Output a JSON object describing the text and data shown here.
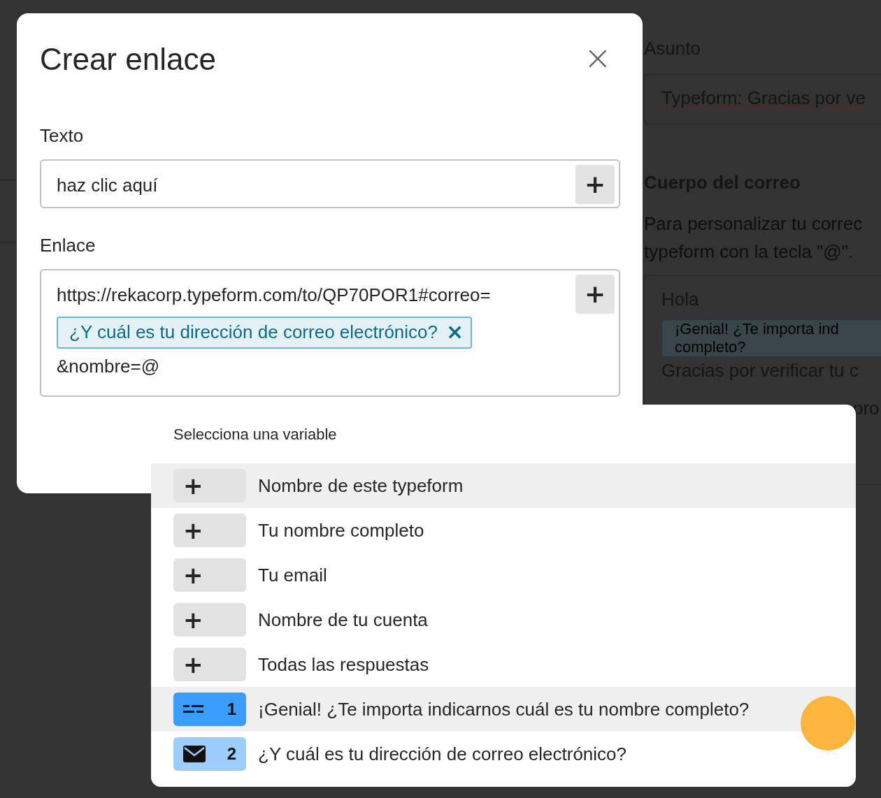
{
  "background": {
    "subject_label": "Asunto",
    "subject_value": "Typeform: Gracias por ve",
    "body_label": "Cuerpo del correo",
    "body_hint": [
      "Para personalizar tu correc",
      "typeform con la tecla \"@\"."
    ],
    "body_greeting": "Hola",
    "body_tag_lines": [
      "¡Genial! ¿Te importa ind",
      "completo?"
    ],
    "body_line": "Gracias por verificar tu c",
    "body_fragment": "pro"
  },
  "dialog": {
    "title": "Crear enlace",
    "close": "×",
    "text_field": {
      "label": "Texto",
      "value": "haz clic aquí",
      "add": "+"
    },
    "link_field": {
      "label": "Enlace",
      "value_before": "https://rekacorp.typeform.com/to/QP70POR1#correo=",
      "tag": "¿Y cuál es tu dirección de correo electrónico?",
      "tag_remove": "×",
      "value_after": "&nombre=@",
      "add": "+"
    }
  },
  "variable_menu": {
    "title": "Selecciona una variable",
    "items": [
      {
        "kind": "add",
        "icon": "+",
        "label": "Nombre de este typeform",
        "selected": true
      },
      {
        "kind": "add",
        "icon": "+",
        "label": "Tu nombre completo",
        "selected": false
      },
      {
        "kind": "add",
        "icon": "+",
        "label": "Tu email",
        "selected": false
      },
      {
        "kind": "add",
        "icon": "+",
        "label": "Nombre de tu cuenta",
        "selected": false
      },
      {
        "kind": "add",
        "icon": "+",
        "label": "Todas las respuestas",
        "selected": false
      },
      {
        "kind": "short_text",
        "number": "1",
        "label": "¡Genial! ¿Te importa indicarnos cuál es tu nombre completo?",
        "selected": true
      },
      {
        "kind": "email",
        "number": "2",
        "label": "¿Y cuál es tu dirección de correo electrónico?",
        "selected": false
      }
    ]
  }
}
